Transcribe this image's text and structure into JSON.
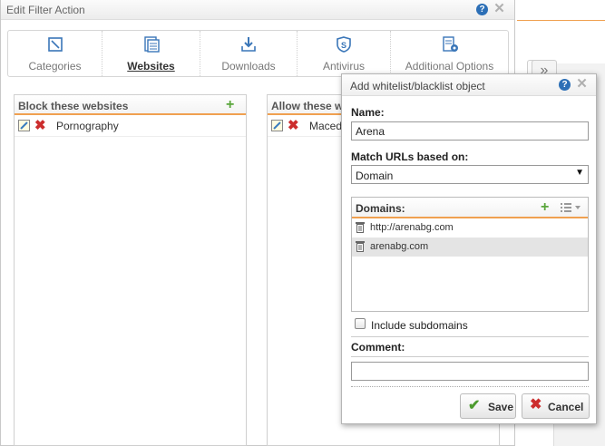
{
  "main_dialog": {
    "title": "Edit Filter Action",
    "help": "?",
    "close": "✕",
    "tabs": [
      {
        "label": "Categories",
        "icon": "categories-icon"
      },
      {
        "label": "Websites",
        "icon": "websites-icon",
        "active": true
      },
      {
        "label": "Downloads",
        "icon": "downloads-icon"
      },
      {
        "label": "Antivirus",
        "icon": "antivirus-icon"
      },
      {
        "label": "Additional Options",
        "icon": "options-icon"
      }
    ]
  },
  "block_panel": {
    "title": "Block these websites",
    "add": "+",
    "rows": [
      {
        "label": "Pornography"
      }
    ]
  },
  "allow_panel": {
    "title": "Allow these w",
    "rows": [
      {
        "label": "Maced"
      }
    ]
  },
  "background": {
    "chevron": "»"
  },
  "popup": {
    "title": "Add whitelist/blacklist object",
    "help": "?",
    "close": "✕",
    "name_label": "Name:",
    "name_value": "Arena",
    "match_label": "Match URLs based on:",
    "match_value": "Domain",
    "select_arrow": "▼",
    "domains_label": "Domains:",
    "add": "+",
    "domains": [
      {
        "value": "http://arenabg.com",
        "selected": false
      },
      {
        "value": "arenabg.com",
        "selected": true
      }
    ],
    "include_subdomains_label": "Include subdomains",
    "comment_label": "Comment:",
    "comment_value": "",
    "save_label": "Save",
    "cancel_label": "Cancel"
  },
  "colors": {
    "accent_orange": "#f0a050",
    "help_blue": "#2c6fb6",
    "add_green": "#5aa63c",
    "delete_red": "#cc2d2d"
  }
}
